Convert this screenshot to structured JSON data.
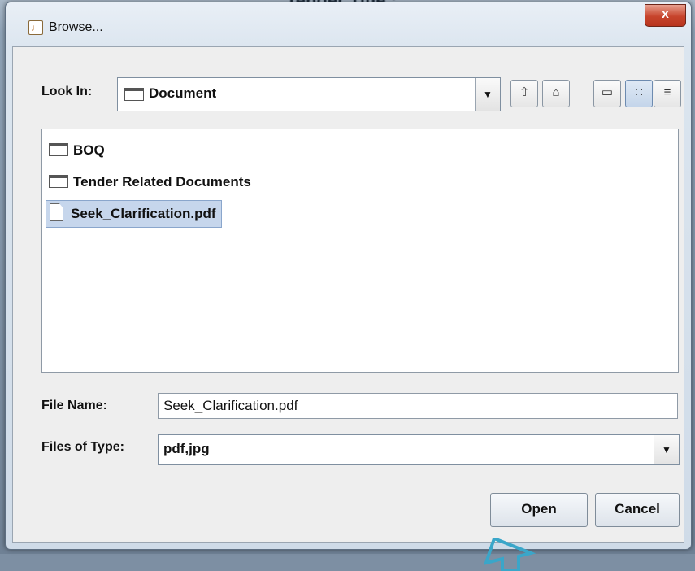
{
  "background": {
    "title": "Tender Title :"
  },
  "dialog": {
    "title": "Browse...",
    "close_glyph": "x",
    "look_in": {
      "label": "Look In:",
      "value": "Document"
    },
    "toolbar_icons": [
      "up-folder-icon",
      "home-icon",
      "new-folder-icon",
      "list-view-icon",
      "details-view-icon"
    ],
    "files": [
      {
        "name": "BOQ",
        "type": "folder"
      },
      {
        "name": "Tender Related Documents",
        "type": "folder"
      },
      {
        "name": "Seek_Clarification.pdf",
        "type": "file",
        "selected": true
      }
    ],
    "file_name": {
      "label": "File Name:",
      "value": "Seek_Clarification.pdf"
    },
    "files_of_type": {
      "label": "Files of Type:",
      "value": "pdf,jpg"
    },
    "open_label": "Open",
    "cancel_label": "Cancel"
  },
  "colors": {
    "selection": "#c6d6ec",
    "close": "#c7442c",
    "cursor": "#3aa6c9"
  }
}
